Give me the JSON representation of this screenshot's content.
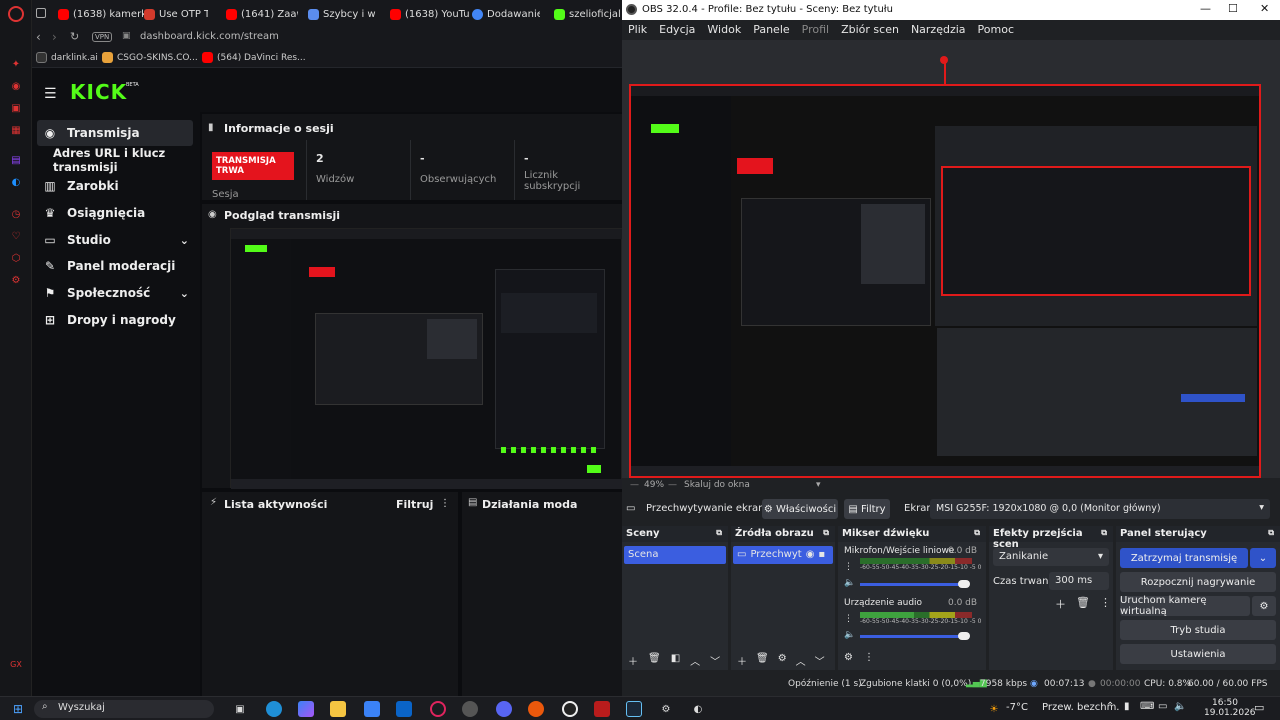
{
  "browser": {
    "tabs": [
      {
        "label": "(1638) kamerk",
        "color": "#ff0000"
      },
      {
        "label": "Use OTP To P",
        "color": "#d33a2c"
      },
      {
        "label": "(1641) Zaawan",
        "color": "#ff0000"
      },
      {
        "label": "Szybcy i wśc",
        "color": "#5b8def"
      },
      {
        "label": "(1638) YouTu",
        "color": "#ff0000"
      },
      {
        "label": "Dodawanie m",
        "color": "#4285f4"
      },
      {
        "label": "szelioficjalni",
        "color": "#53fc18"
      }
    ],
    "vpn": "VPN",
    "url": "dashboard.kick.com/stream",
    "bookmarks": [
      "darklink.ai",
      "CSGO-SKINS.CO...",
      "(564) DaVinci Res..."
    ]
  },
  "kick": {
    "logo": "KICK",
    "beta": "BETA",
    "nav": [
      {
        "label": "Transmisja",
        "icon": "broadcast-icon"
      },
      {
        "label": "Adres URL i klucz transmisji",
        "icon": ""
      },
      {
        "label": "Zarobki",
        "icon": "earnings-icon"
      },
      {
        "label": "Osiągnięcia",
        "icon": "trophy-icon"
      },
      {
        "label": "Studio",
        "icon": "studio-icon"
      },
      {
        "label": "Panel moderacji",
        "icon": "wrench-icon"
      },
      {
        "label": "Społeczność",
        "icon": "community-icon"
      },
      {
        "label": "Dropy i nagrody",
        "icon": "gift-icon"
      }
    ],
    "session": {
      "title": "Informacje o sesji",
      "status": "TRANSMISJA TRWA",
      "status_label": "Sesja",
      "stats": [
        {
          "value": "2",
          "label": "Widzów"
        },
        {
          "value": "-",
          "label": "Obserwujących"
        },
        {
          "value": "-",
          "label": "Licznik subskrypcji"
        }
      ]
    },
    "preview_title": "Podgląd transmisji",
    "activity_title": "Lista aktywności",
    "activity_filter": "Filtruj",
    "mod_title": "Działania moda",
    "accent": "#53fc18"
  },
  "obs": {
    "title": "OBS 32.0.4 - Profile: Bez tytułu - Sceny: Bez tytułu",
    "menu": [
      "Plik",
      "Edycja",
      "Widok",
      "Panele",
      "Profil",
      "Zbiór scen",
      "Narzędzia",
      "Pomoc"
    ],
    "zoom": "49%",
    "zoom_mode": "Skaluj do okna",
    "source_bar": {
      "source": "Przechwytywanie ekranu",
      "properties": "Właściwości",
      "filters": "Filtry",
      "screen_label": "Ekran",
      "screen_value": "MSI G255F: 1920x1080 @ 0,0 (Monitor główny)"
    },
    "docks": {
      "scenes": {
        "title": "Sceny",
        "items": [
          "Scena"
        ]
      },
      "sources": {
        "title": "Źródła obrazu",
        "items": [
          "Przechwyt"
        ]
      },
      "mixer": {
        "title": "Mikser dźwięku",
        "channels": [
          {
            "name": "Mikrofon/Wejście liniowe",
            "db": "0.0 dB"
          },
          {
            "name": "Urządzenie audio",
            "db": "0.0 dB"
          }
        ],
        "scale": "-60-55-50-45-40-35-30-25-20-15-10 -5 0"
      },
      "transitions": {
        "title": "Efekty przejścia scen",
        "effect": "Zanikanie",
        "duration_label": "Czas trwania",
        "duration": "300 ms"
      },
      "controls": {
        "title": "Panel sterujący",
        "buttons": [
          "Zatrzymaj transmisję",
          "Rozpocznij nagrywanie",
          "Uruchom kamerę wirtualną",
          "Tryb studia",
          "Ustawienia"
        ]
      }
    },
    "status": {
      "delay": "Opóźnienie (1 s)",
      "dropped": "Zgubione klatki 0 (0,0%)",
      "bitrate": "7958 kbps",
      "stream_time": "00:07:13",
      "rec_time": "00:00:00",
      "cpu": "CPU: 0.8%",
      "fps": "60.00 / 60.00 FPS"
    }
  },
  "taskbar": {
    "search": "Wyszukaj",
    "weather": "-7°C",
    "weather_desc": "Przew. bezchm.",
    "time": "16:50",
    "date": "19.01.2026"
  }
}
